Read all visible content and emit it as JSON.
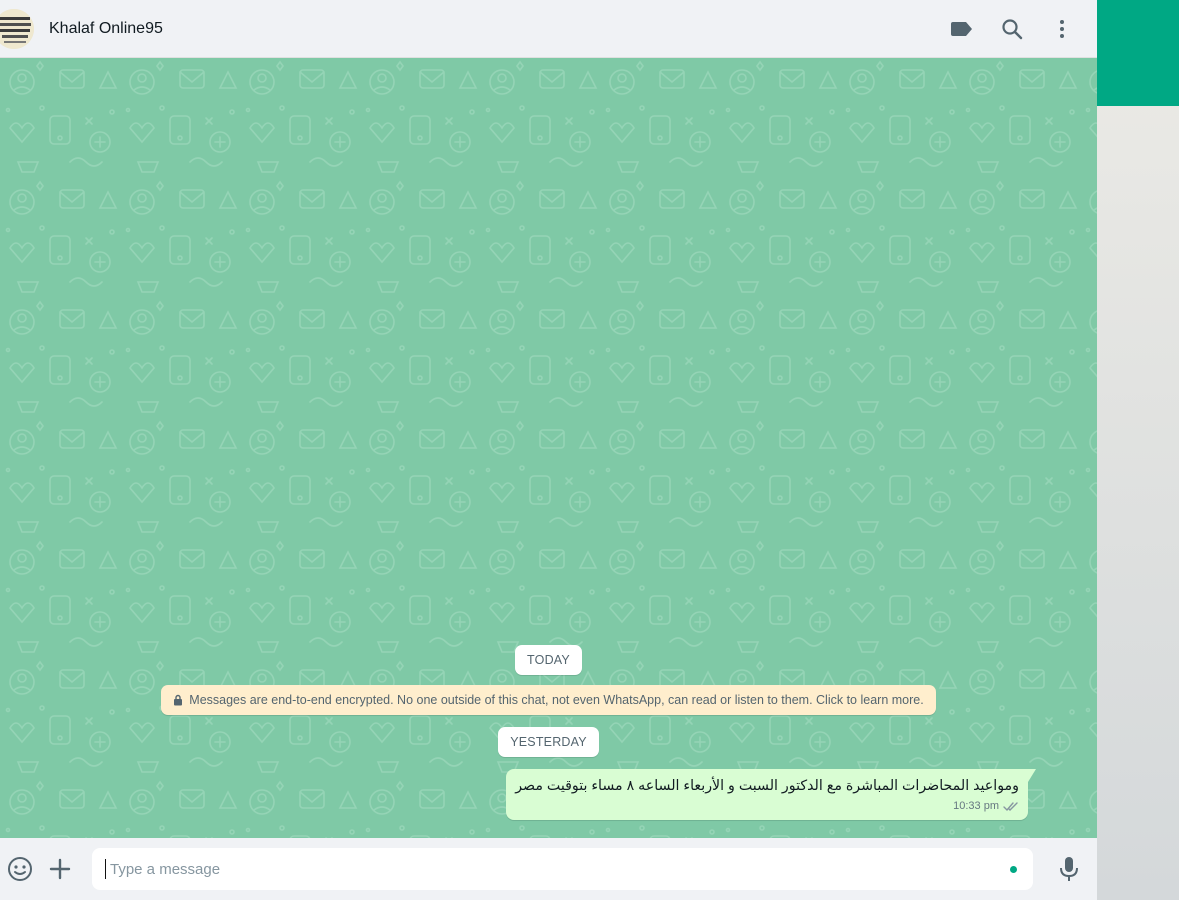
{
  "chat": {
    "contact_name": "Khalaf Online95",
    "header_icons": [
      "label-icon",
      "search-icon",
      "menu-dots-icon"
    ]
  },
  "messages": {
    "date_today": "TODAY",
    "encryption_notice": "Messages are end-to-end encrypted. No one outside of this chat, not even WhatsApp, can read or listen to them. Click to learn more.",
    "date_yesterday": "YESTERDAY",
    "items": [
      {
        "text": "ومواعيد المحاضرات المباشرة مع الدكتور السبت و الأربعاء الساعه ٨ مساء بتوقيت مصر",
        "time": "10:33 pm",
        "status": "read"
      }
    ]
  },
  "composer": {
    "placeholder": "Type a message",
    "value": ""
  },
  "colors": {
    "wallpaper": "#7fc9a6",
    "outgoing_bubble": "#d9fdd3",
    "notice_bg": "#ffeecd",
    "accent": "#00a884",
    "header_bg": "#f0f2f5"
  }
}
